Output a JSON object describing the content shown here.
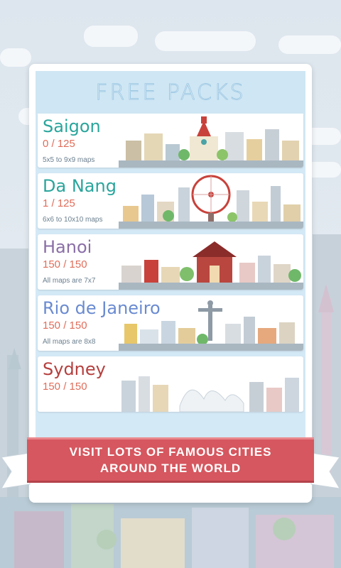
{
  "header": {
    "title": "FREE PACKS"
  },
  "packs": [
    {
      "name": "Saigon",
      "progress": "0 / 125",
      "meta": "5x5 to 9x9 maps",
      "color": "#2aa59c"
    },
    {
      "name": "Da Nang",
      "progress": "1 / 125",
      "meta": "6x6 to 10x10 maps",
      "color": "#2aa59c"
    },
    {
      "name": "Hanoi",
      "progress": "150 / 150",
      "meta": "All maps are 7x7",
      "color": "#8a6fa6"
    },
    {
      "name": "Rio de Janeiro",
      "progress": "150 / 150",
      "meta": "All maps are 8x8",
      "color": "#6a8bd1"
    },
    {
      "name": "Sydney",
      "progress": "150 / 150",
      "meta": "",
      "color": "#b5403e"
    }
  ],
  "banner": {
    "line1": "VISIT LOTS OF FAMOUS CITIES",
    "line2": "AROUND THE WORLD"
  },
  "colors": {
    "banner": "#d6575f",
    "progress": "#e06d5a",
    "header": "#cfe6f4"
  }
}
